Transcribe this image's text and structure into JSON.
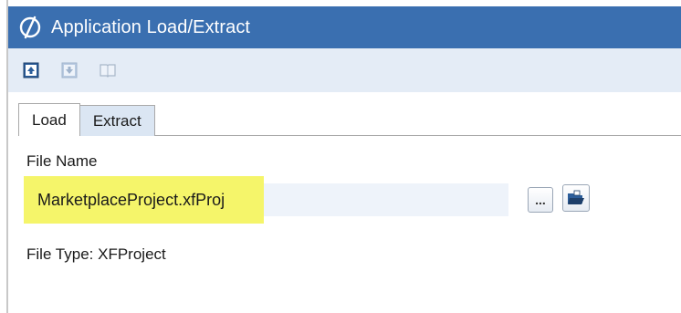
{
  "window": {
    "title": "Application Load/Extract"
  },
  "toolbar": {
    "buttons": [
      {
        "icon": "load-icon"
      },
      {
        "icon": "extract-icon"
      },
      {
        "icon": "book-icon"
      }
    ]
  },
  "tabs": [
    {
      "label": "Load",
      "active": true
    },
    {
      "label": "Extract",
      "active": false
    }
  ],
  "form": {
    "file_name_label": "File Name",
    "file_name_value": "MarketplaceProject.xfProj",
    "browse_label": "...",
    "file_type_text": "File Type: XFProject"
  },
  "colors": {
    "titlebar": "#3a6fb0",
    "toolbar": "#e4ecf6",
    "highlight": "#f5f56a"
  }
}
